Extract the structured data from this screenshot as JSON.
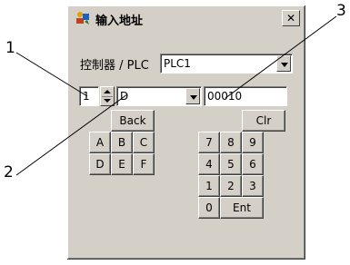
{
  "callouts": {
    "one": "1",
    "two": "2",
    "three": "3"
  },
  "dialog": {
    "title": "输入地址",
    "close_label": "✕",
    "controller_label": "控制器 / PLC",
    "controller_value": "PLC1",
    "spinner_value": "1",
    "device_value": "D",
    "address_value": "00010"
  },
  "keypad": {
    "back": "Back",
    "clr": "Clr",
    "letters": [
      "A",
      "B",
      "C",
      "D",
      "E",
      "F"
    ],
    "digits": [
      "7",
      "8",
      "9",
      "4",
      "5",
      "6",
      "1",
      "2",
      "3"
    ],
    "zero": "0",
    "ent": "Ent"
  },
  "colors": {
    "dialog_bg": "#d4d0c8",
    "field_bg": "#ffffff"
  }
}
